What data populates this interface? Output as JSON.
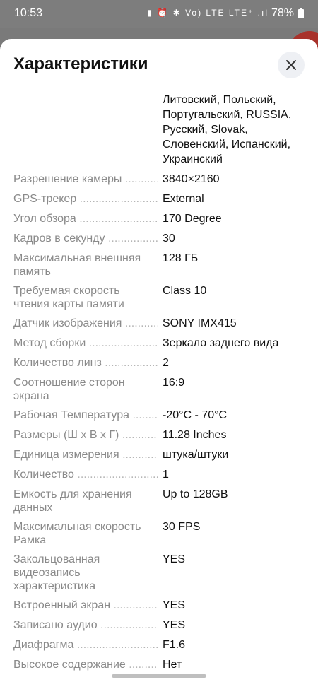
{
  "status_bar": {
    "time": "10:53",
    "icons": "▮ ⏰ ✱ Vo) LTE LTE⁺ .ıl",
    "battery": "78%"
  },
  "sheet": {
    "title": "Характеристики",
    "close_icon": "close-icon"
  },
  "languages_value": "Литовский, Польский, Португальский, RUSSIA, Русский, Slovak, Словенский, Испанский, Украинский",
  "specs": [
    {
      "label": "Разрешение камеры",
      "value": "3840×2160"
    },
    {
      "label": "GPS-трекер",
      "value": "External"
    },
    {
      "label": "Угол обзора",
      "value": "170 Degree"
    },
    {
      "label": "Кадров в секунду",
      "value": "30"
    },
    {
      "label": "Максимальная внешняя память",
      "value": "128 ГБ"
    },
    {
      "label": "Требуемая скорость чтения карты памяти",
      "value": "Class 10"
    },
    {
      "label": "Датчик изображения",
      "value": "SONY IMX415"
    },
    {
      "label": "Метод сборки",
      "value": "Зеркало заднего вида"
    },
    {
      "label": "Количество линз",
      "value": "2"
    },
    {
      "label": "Соотношение сторон экрана",
      "value": "16:9"
    },
    {
      "label": "Рабочая Температура",
      "value": "-20°C - 70°C"
    },
    {
      "label": "Размеры (Ш x В x Г)",
      "value": "11.28 Inches"
    },
    {
      "label": "Единица измерения",
      "value": "штука/штуки"
    },
    {
      "label": "Количество",
      "value": "1"
    },
    {
      "label": "Емкость для хранения данных",
      "value": "Up to 128GB"
    },
    {
      "label": "Максимальная скорость Рамка",
      "value": "30 FPS"
    },
    {
      "label": "Закольцованная видеозапись характеристика",
      "value": "YES"
    },
    {
      "label": "Встроенный экран",
      "value": "YES"
    },
    {
      "label": "Записано аудио",
      "value": "YES"
    },
    {
      "label": "Диафрагма",
      "value": "F1.6"
    },
    {
      "label": "Высокое содержание",
      "value": "Нет"
    }
  ]
}
